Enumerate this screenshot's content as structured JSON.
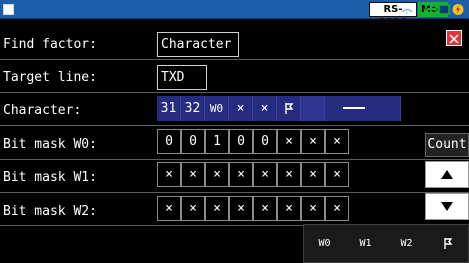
{
  "status_bar": {
    "interface": "RS-232C",
    "mode": "Mon",
    "icons": [
      "menu-square-icon",
      "signal-icon",
      "card-icon",
      "square-icon",
      "power-icon"
    ],
    "colors": {
      "bar": "#1c5ea8",
      "mode_badge": "#14b42a",
      "close": "#e6333b",
      "char_row": "#252b7e"
    }
  },
  "labels": {
    "find_factor": "Find factor:",
    "target_line": "Target line:",
    "character": "Character:",
    "bit_mask_w0": "Bit mask W0:",
    "bit_mask_w1": "Bit mask W1:",
    "bit_mask_w2": "Bit mask W2:"
  },
  "fields": {
    "find_factor": "Character",
    "target_line": "TXD"
  },
  "character_cells": [
    "31",
    "32",
    "W0",
    "×",
    "×",
    "F",
    "",
    ""
  ],
  "bit_masks": {
    "w0": [
      "0",
      "0",
      "1",
      "0",
      "0",
      "×",
      "×",
      "×"
    ],
    "w1": [
      "×",
      "×",
      "×",
      "×",
      "×",
      "×",
      "×",
      "×"
    ],
    "w2": [
      "×",
      "×",
      "×",
      "×",
      "×",
      "×",
      "×",
      "×"
    ]
  },
  "buttons": {
    "count": "Count",
    "up": "▲",
    "down": "▼",
    "close": "close-icon"
  },
  "keys": {
    "w0": "W0",
    "w1": "W1",
    "w2": "W2",
    "flag": "flag-icon"
  }
}
